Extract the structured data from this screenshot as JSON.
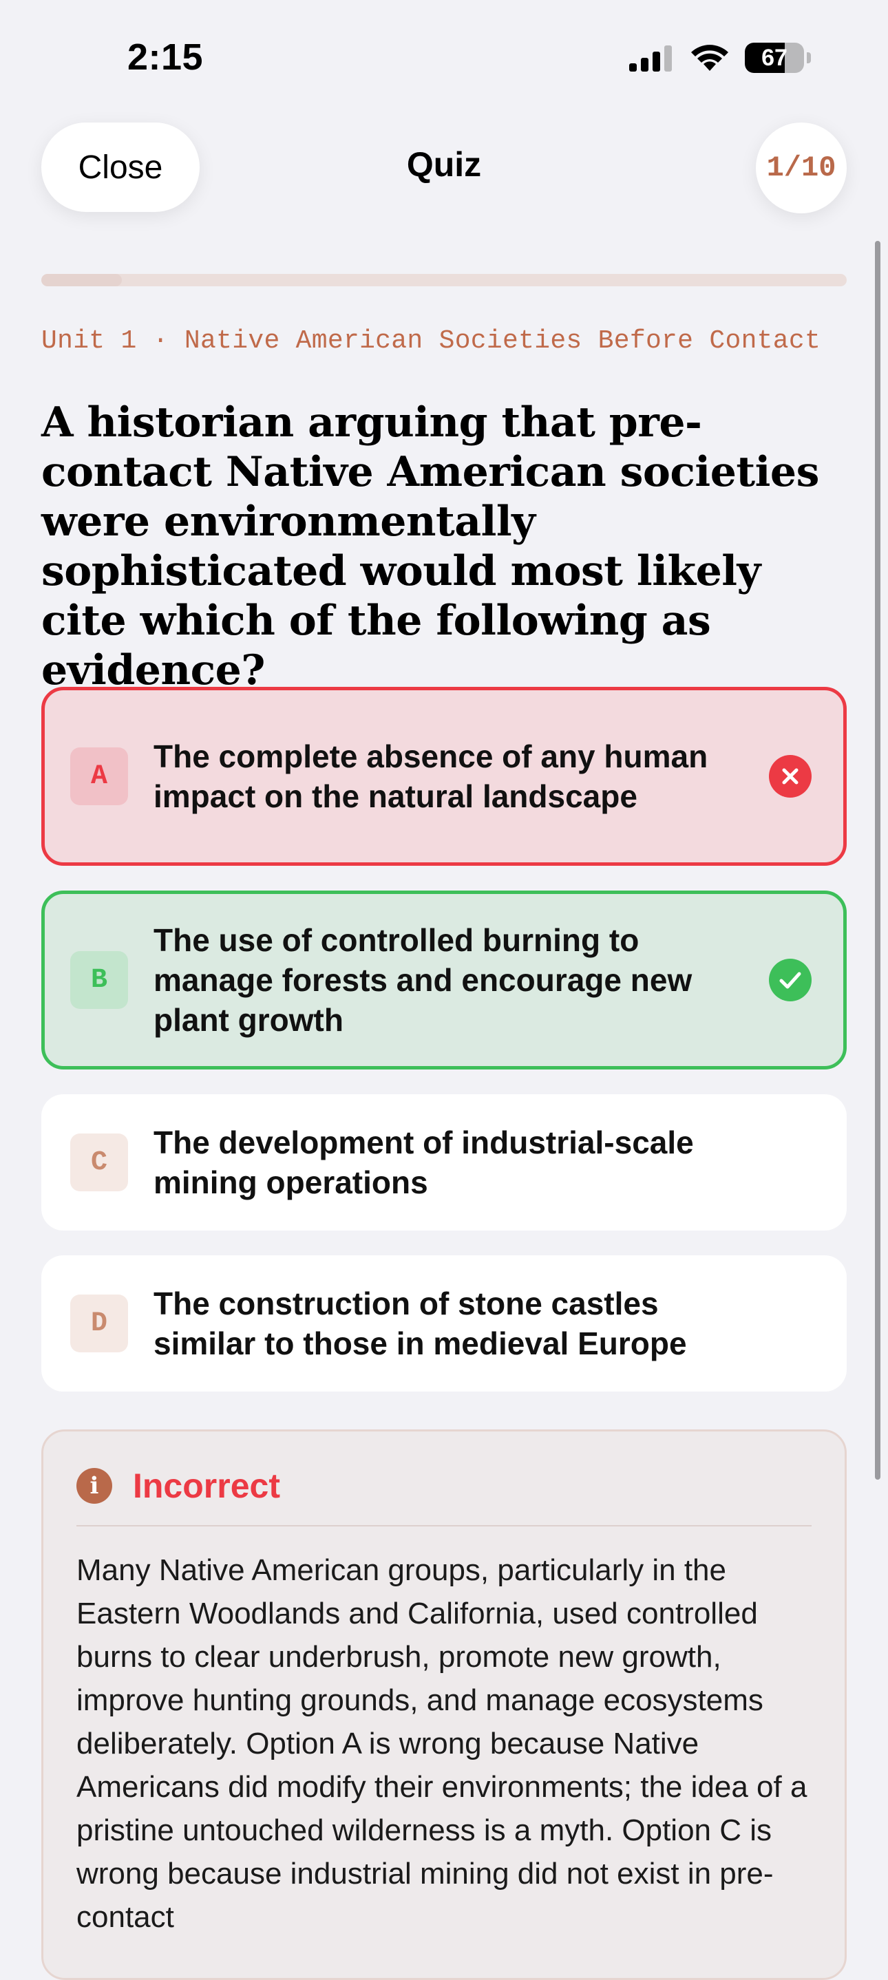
{
  "status_bar": {
    "time": "2:15",
    "battery": "67",
    "battery_level": 0.67
  },
  "nav": {
    "close_label": "Close",
    "title": "Quiz",
    "counter": "1/10"
  },
  "progress": {
    "fraction": 0.1
  },
  "unit_label": "Unit 1 · Native American Societies Before Contact",
  "question": "A historian arguing that pre-contact Native American societies were environmentally sophisticated would most likely cite which of the following as evidence?",
  "options": [
    {
      "letter": "A",
      "text": "The complete absence of any human impact on the natural landscape",
      "state": "incorrect-selected"
    },
    {
      "letter": "B",
      "text": "The use of controlled burning to manage forests and encourage new plant growth",
      "state": "correct"
    },
    {
      "letter": "C",
      "text": "The development of industrial-scale mining operations",
      "state": "neutral"
    },
    {
      "letter": "D",
      "text": "The construction of stone castles similar to those in medieval Europe",
      "state": "neutral"
    }
  ],
  "feedback": {
    "title": "Incorrect",
    "body": "Many Native American groups, particularly in the Eastern Woodlands and California, used controlled burns to clear underbrush, promote new growth, improve hunting grounds, and manage ecosystems deliberately. Option A is wrong because Native Americans did modify their environments; the idea of a pristine untouched wilderness is a myth. Option C is wrong because industrial mining did not exist in pre-contact"
  },
  "colors": {
    "accent": "#b9694a",
    "incorrect": "#ec3a44",
    "correct": "#3dbf59",
    "background": "#f2f2f6"
  },
  "icons": {
    "incorrect_mark": "x-circle-icon",
    "correct_mark": "checkmark-circle-icon",
    "feedback": "info-icon"
  }
}
